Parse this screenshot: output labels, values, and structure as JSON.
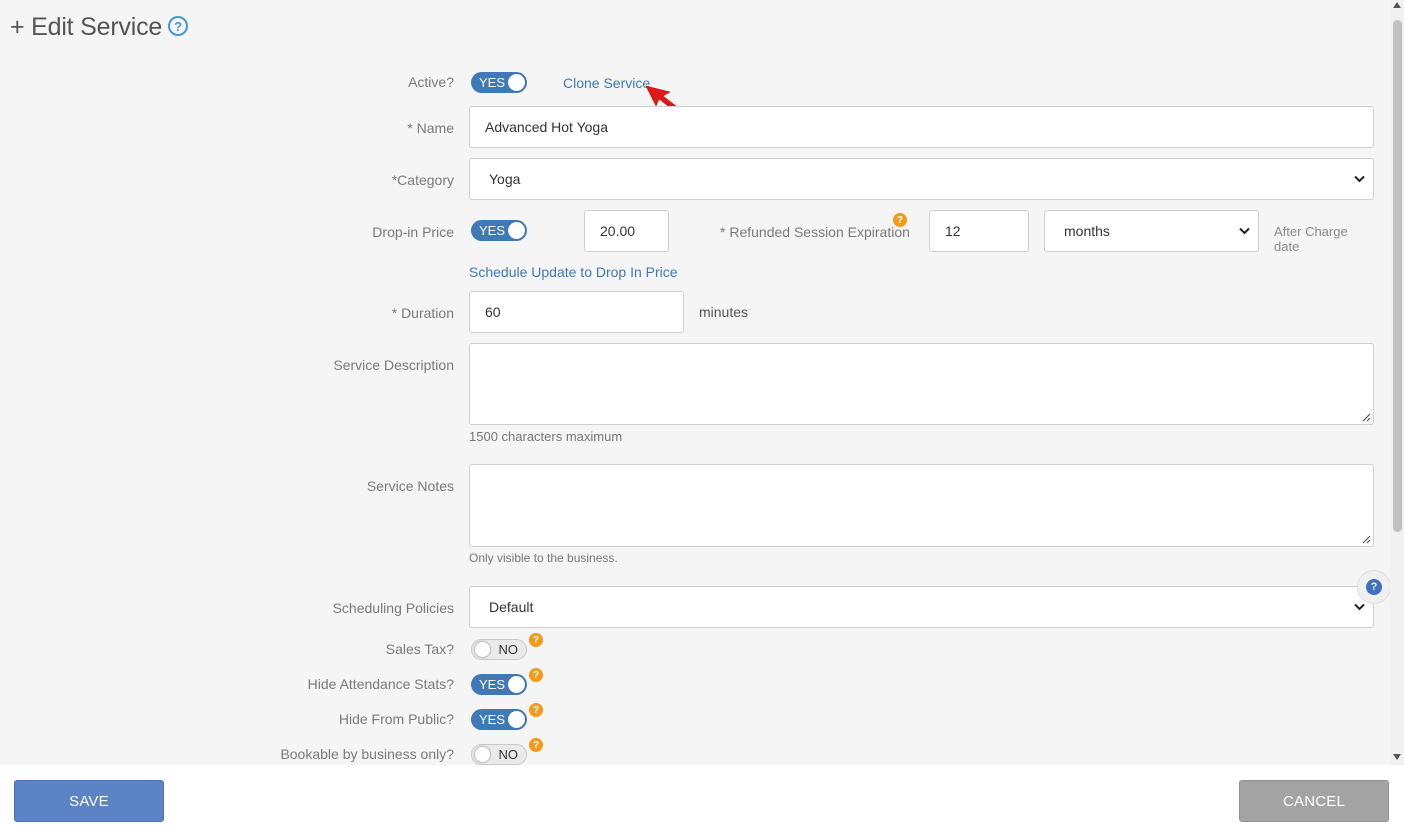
{
  "header": {
    "title": "+ Edit Service",
    "help_icon": "question-circle-icon"
  },
  "active": {
    "label": "Active?",
    "toggle": "YES",
    "clone_link": "Clone Service"
  },
  "name": {
    "label": "* Name",
    "value": "Advanced Hot Yoga"
  },
  "category": {
    "label": "*Category",
    "value": "Yoga"
  },
  "dropin": {
    "label": "Drop-in Price",
    "toggle": "YES",
    "price": "20.00",
    "refund_label": "* Refunded Session Expiration",
    "refund_value": "12",
    "refund_unit": "months",
    "after_text": "After Charge date",
    "schedule_link": "Schedule Update to Drop In Price"
  },
  "duration": {
    "label": "* Duration",
    "value": "60",
    "unit": "minutes"
  },
  "description": {
    "label": "Service Description",
    "value": "",
    "hint": "1500 characters maximum"
  },
  "notes": {
    "label": "Service Notes",
    "value": "",
    "hint": "Only visible to the business."
  },
  "scheduling": {
    "label": "Scheduling Policies",
    "value": "Default"
  },
  "sales_tax": {
    "label": "Sales Tax?",
    "toggle": "NO"
  },
  "hide_attendance": {
    "label": "Hide Attendance Stats?",
    "toggle": "YES"
  },
  "hide_public": {
    "label": "Hide From Public?",
    "toggle": "YES"
  },
  "bookable": {
    "label": "Bookable by business only?",
    "toggle": "NO"
  },
  "badge_text": "?",
  "footer": {
    "save_label": "SAVE",
    "cancel_label": "CANCEL"
  },
  "colors": {
    "accent": "#3f79b8",
    "badge": "#f39a1b",
    "save": "#5b84c6",
    "cancel": "#a3a3a3"
  }
}
